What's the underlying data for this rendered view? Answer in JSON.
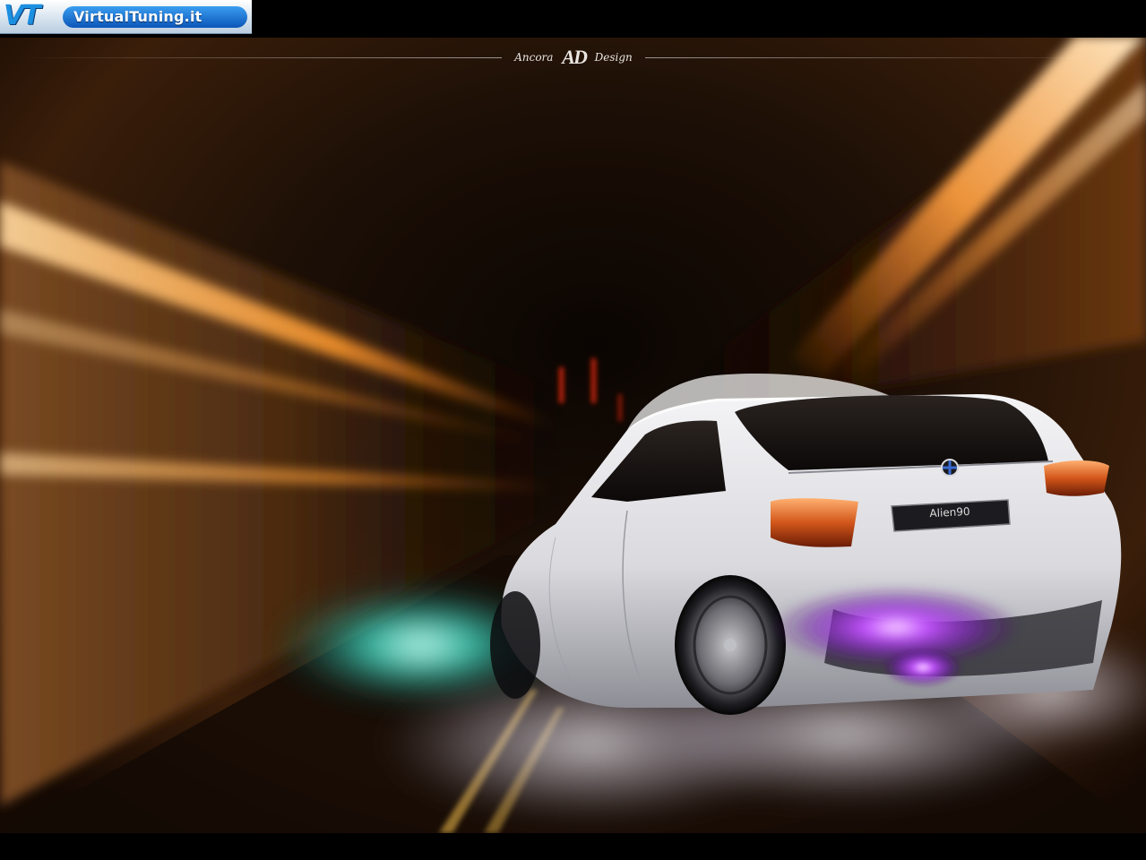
{
  "watermark": {
    "mark": "VT",
    "site": "VirtualTuning.it"
  },
  "brand": {
    "left_word": "Ancora",
    "monogram": "AD",
    "right_word": "Design"
  },
  "car": {
    "plate": "Alien90"
  },
  "colors": {
    "tunnel_light": "#ff9a2e",
    "tunnel_dark": "#1a0d03",
    "car_body": "#e8e8ea",
    "underglow": "#b03cff",
    "teal_glow": "#3fe0c8",
    "vt_blue": "#1c7fe0"
  }
}
